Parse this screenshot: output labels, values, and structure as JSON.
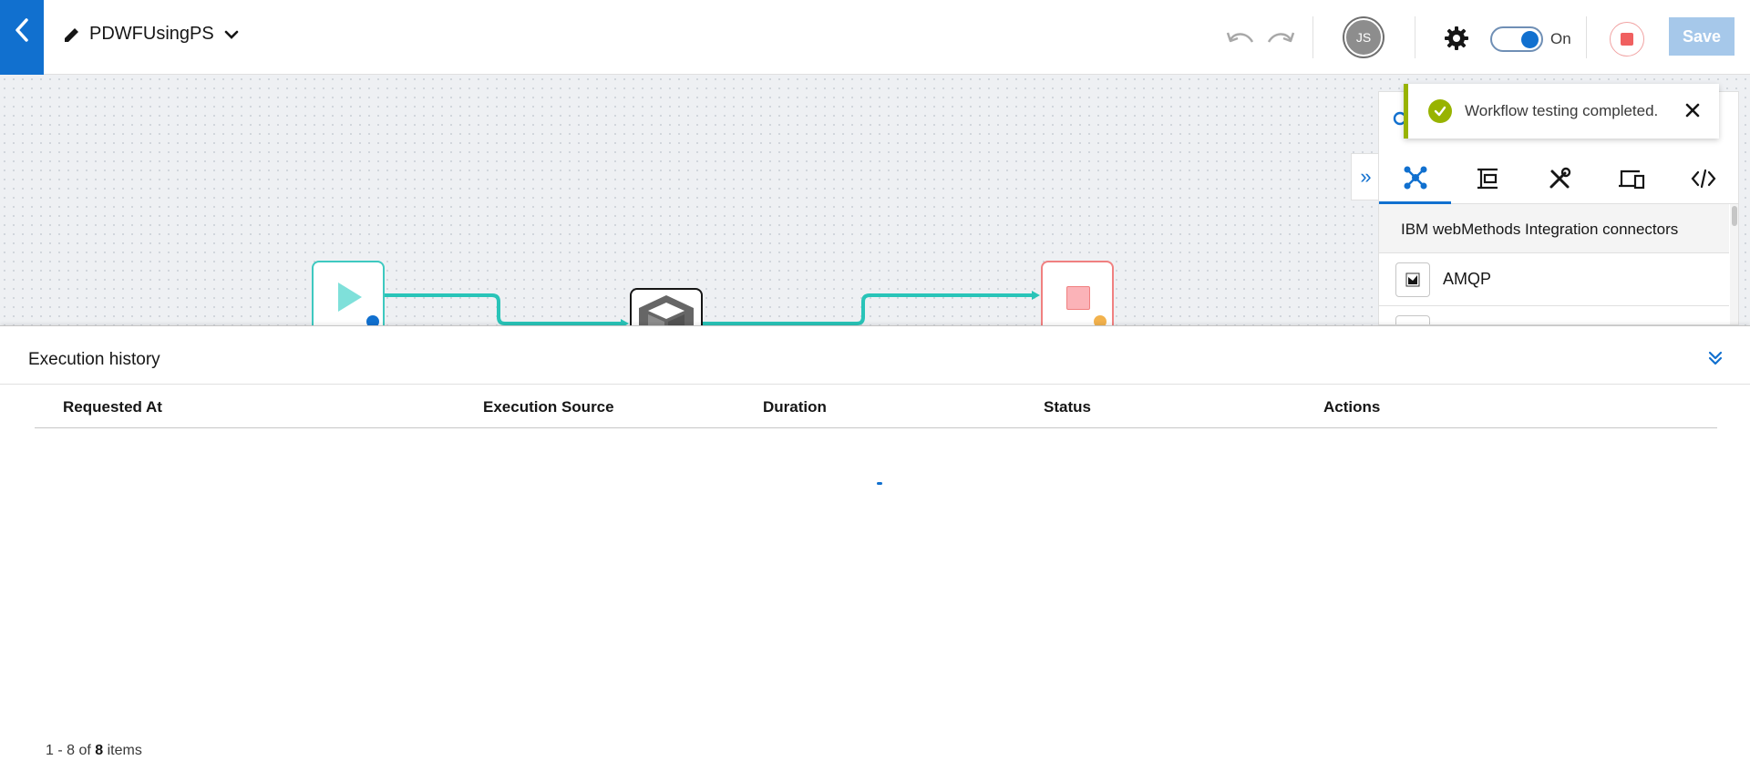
{
  "header": {
    "workflow_name": "PDWFUsingPS",
    "avatar_initials": "JS",
    "toggle_label": "On",
    "save_label": "Save"
  },
  "palette": {
    "section_title": "IBM webMethods Integration connectors",
    "items": [
      {
        "label": "AMQP"
      }
    ],
    "tabs": [
      "connectors-icon",
      "flow-steps-icon",
      "tools-icon",
      "devices-icon",
      "code-icon"
    ]
  },
  "toast": {
    "message": "Workflow testing completed."
  },
  "history": {
    "title": "Execution history",
    "columns": [
      "Requested At",
      "Execution Source",
      "Duration",
      "Status",
      "Actions"
    ],
    "pager_prefix": "1 - 8 of ",
    "pager_total": "8",
    "pager_suffix": " items"
  },
  "colors": {
    "accent": "#1170cf",
    "success": "#98b300",
    "connector_line": "#3ec9c0",
    "stop": "#f06060"
  }
}
